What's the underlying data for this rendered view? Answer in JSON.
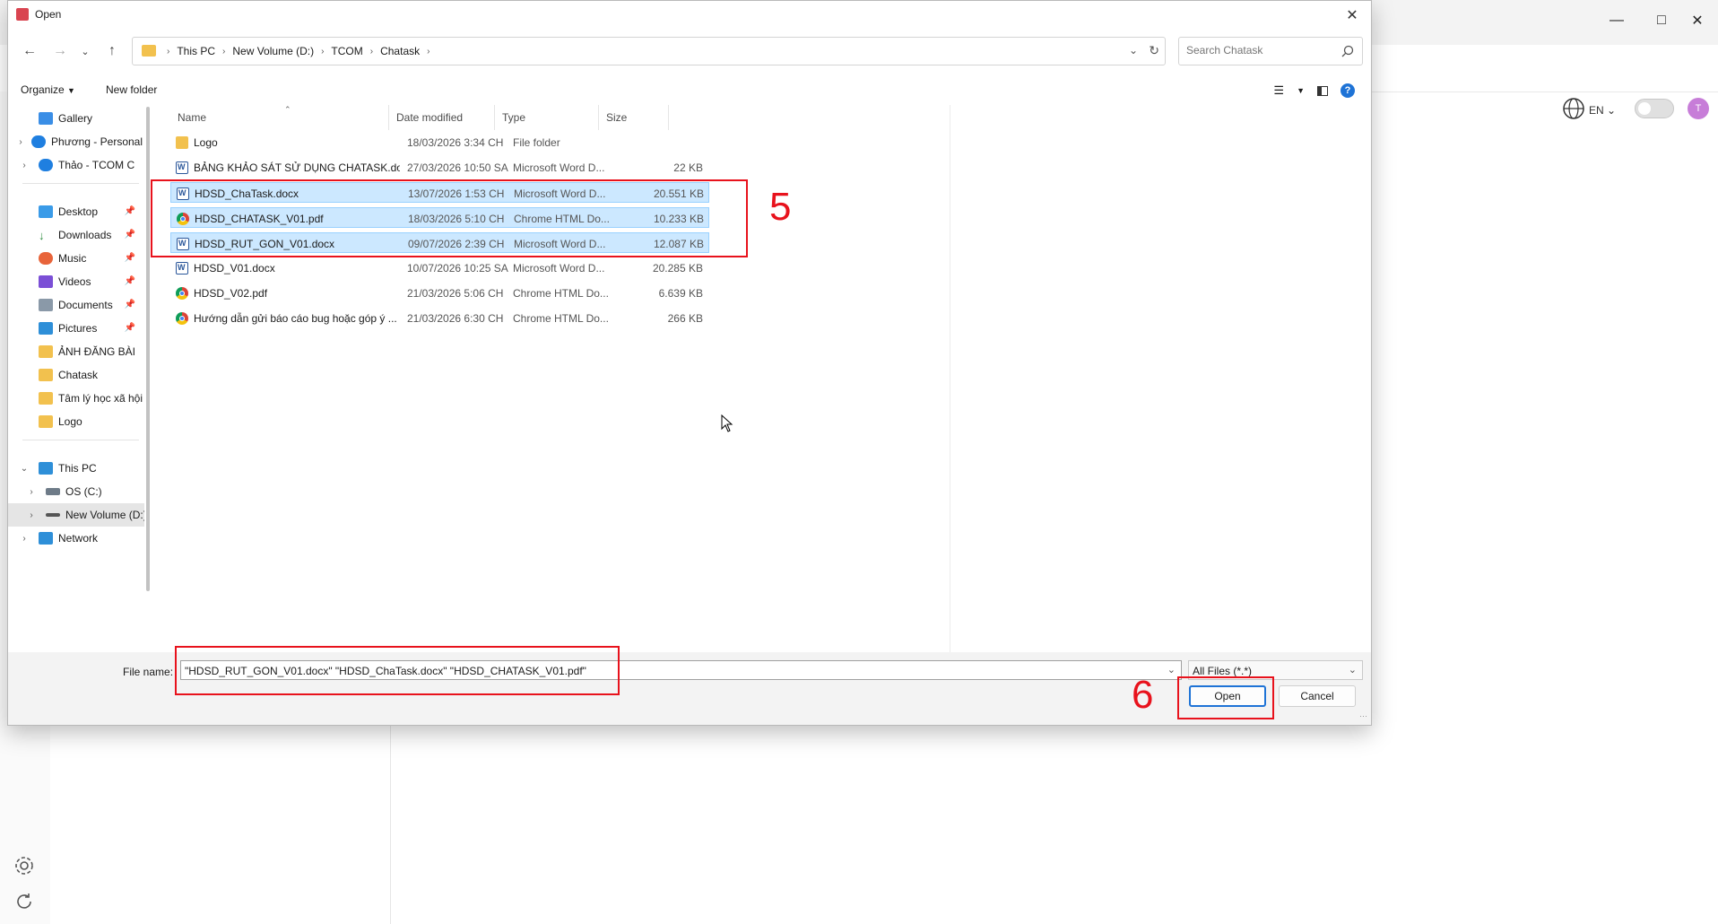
{
  "dialog": {
    "title": "Open",
    "breadcrumb": [
      "This PC",
      "New Volume (D:)",
      "TCOM",
      "Chatask"
    ],
    "search_placeholder": "Search Chatask",
    "commands": {
      "organize": "Organize",
      "new_folder": "New folder"
    },
    "nav_items": [
      {
        "label": "Gallery",
        "icon": "gallery-icon",
        "expandable": false,
        "pinned": false
      },
      {
        "label": "Phương - Personal",
        "icon": "onedrive-icon",
        "expandable": true,
        "pinned": false
      },
      {
        "label": "Thảo - TCOM C",
        "icon": "onedrive-icon",
        "expandable": true,
        "pinned": false
      },
      {
        "label": "Desktop",
        "icon": "desktop-icon",
        "expandable": false,
        "pinned": true
      },
      {
        "label": "Downloads",
        "icon": "download-icon",
        "expandable": false,
        "pinned": true
      },
      {
        "label": "Music",
        "icon": "music-icon",
        "expandable": false,
        "pinned": true
      },
      {
        "label": "Videos",
        "icon": "video-icon",
        "expandable": false,
        "pinned": true
      },
      {
        "label": "Documents",
        "icon": "document-icon",
        "expandable": false,
        "pinned": true
      },
      {
        "label": "Pictures",
        "icon": "pictures-icon",
        "expandable": false,
        "pinned": true
      },
      {
        "label": "ẢNH ĐĂNG BÀI",
        "icon": "folder-icon",
        "expandable": false,
        "pinned": false
      },
      {
        "label": "Chatask",
        "icon": "folder-icon",
        "expandable": false,
        "pinned": false
      },
      {
        "label": "Tâm lý học xã hội",
        "icon": "folder-icon",
        "expandable": false,
        "pinned": false
      },
      {
        "label": "Logo",
        "icon": "folder-icon",
        "expandable": false,
        "pinned": false
      },
      {
        "label": "This PC",
        "icon": "pc-icon",
        "expandable": true,
        "pinned": false
      },
      {
        "label": "OS (C:)",
        "icon": "drive-icon",
        "expandable": true,
        "pinned": false
      },
      {
        "label": "New Volume (D:)",
        "icon": "drive-icon",
        "expandable": true,
        "pinned": false
      },
      {
        "label": "Network",
        "icon": "network-icon",
        "expandable": true,
        "pinned": false
      }
    ],
    "columns": {
      "name": "Name",
      "date": "Date modified",
      "type": "Type",
      "size": "Size"
    },
    "files": [
      {
        "name": "Logo",
        "date": "18/03/2026 3:34 CH",
        "type": "File folder",
        "size": "",
        "icon": "folder",
        "selected": false
      },
      {
        "name": "BẢNG KHẢO SÁT SỬ DỤNG CHATASK.docx",
        "date": "27/03/2026 10:50 SA",
        "type": "Microsoft Word D...",
        "size": "22 KB",
        "icon": "word",
        "selected": false
      },
      {
        "name": "HDSD_ChaTask.docx",
        "date": "13/07/2026 1:53 CH",
        "type": "Microsoft Word D...",
        "size": "20.551 KB",
        "icon": "word",
        "selected": true
      },
      {
        "name": "HDSD_CHATASK_V01.pdf",
        "date": "18/03/2026 5:10 CH",
        "type": "Chrome HTML Do...",
        "size": "10.233 KB",
        "icon": "chrome",
        "selected": true
      },
      {
        "name": "HDSD_RUT_GON_V01.docx",
        "date": "09/07/2026 2:39 CH",
        "type": "Microsoft Word D...",
        "size": "12.087 KB",
        "icon": "word",
        "selected": true
      },
      {
        "name": "HDSD_V01.docx",
        "date": "10/07/2026 10:25 SA",
        "type": "Microsoft Word D...",
        "size": "20.285 KB",
        "icon": "word",
        "selected": false
      },
      {
        "name": "HDSD_V02.pdf",
        "date": "21/03/2026 5:06 CH",
        "type": "Chrome HTML Do...",
        "size": "6.639 KB",
        "icon": "chrome",
        "selected": false
      },
      {
        "name": "Hướng dẫn gửi báo cáo bug hoặc góp ý ...",
        "date": "21/03/2026 6:30 CH",
        "type": "Chrome HTML Do...",
        "size": "266 KB",
        "icon": "chrome",
        "selected": false
      }
    ],
    "file_name_label": "File name:",
    "file_name_value": "\"HDSD_RUT_GON_V01.docx\" \"HDSD_ChaTask.docx\" \"HDSD_CHATASK_V01.pdf\"",
    "file_type_filter": "All Files (*.*)",
    "open_label": "Open",
    "cancel_label": "Cancel"
  },
  "background_app": {
    "language": "EN",
    "avatar_initial": "T"
  },
  "annotations": {
    "step_files": "5",
    "step_open": "6",
    "color": "#e8121c"
  }
}
